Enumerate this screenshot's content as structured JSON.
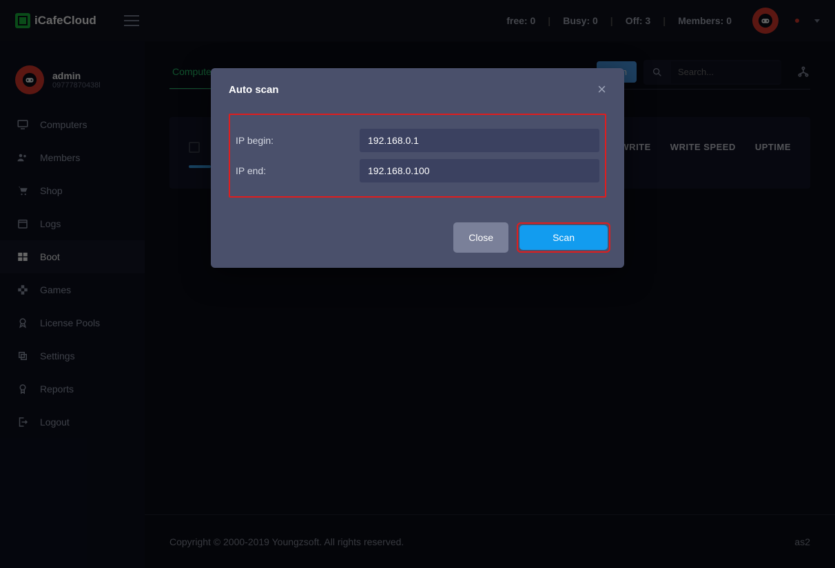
{
  "brand": "iCafeCloud",
  "topbar": {
    "free_label": "free: 0",
    "busy_label": "Busy: 0",
    "off_label": "Off: 3",
    "members_label": "Members: 0"
  },
  "user": {
    "name": "admin",
    "id": "09777870438l"
  },
  "sidebar": {
    "items": [
      {
        "label": "Computers"
      },
      {
        "label": "Members"
      },
      {
        "label": "Shop"
      },
      {
        "label": "Logs"
      },
      {
        "label": "Boot"
      },
      {
        "label": "Games"
      },
      {
        "label": "License Pools"
      },
      {
        "label": "Settings"
      },
      {
        "label": "Reports"
      },
      {
        "label": "Logout"
      }
    ]
  },
  "tabs": {
    "active": "Computers",
    "scan_button": "Scan"
  },
  "search": {
    "placeholder": "Search..."
  },
  "table": {
    "headers_right": [
      "WRITE",
      "WRITE SPEED",
      "UPTIME"
    ]
  },
  "modal": {
    "title": "Auto scan",
    "ip_begin_label": "IP begin:",
    "ip_begin_value": "192.168.0.1",
    "ip_end_label": "IP end:",
    "ip_end_value": "192.168.0.100",
    "close_label": "Close",
    "scan_label": "Scan"
  },
  "footer": {
    "copyright": "Copyright © 2000-2019 Youngzsoft. All rights reserved.",
    "right": "as2"
  }
}
